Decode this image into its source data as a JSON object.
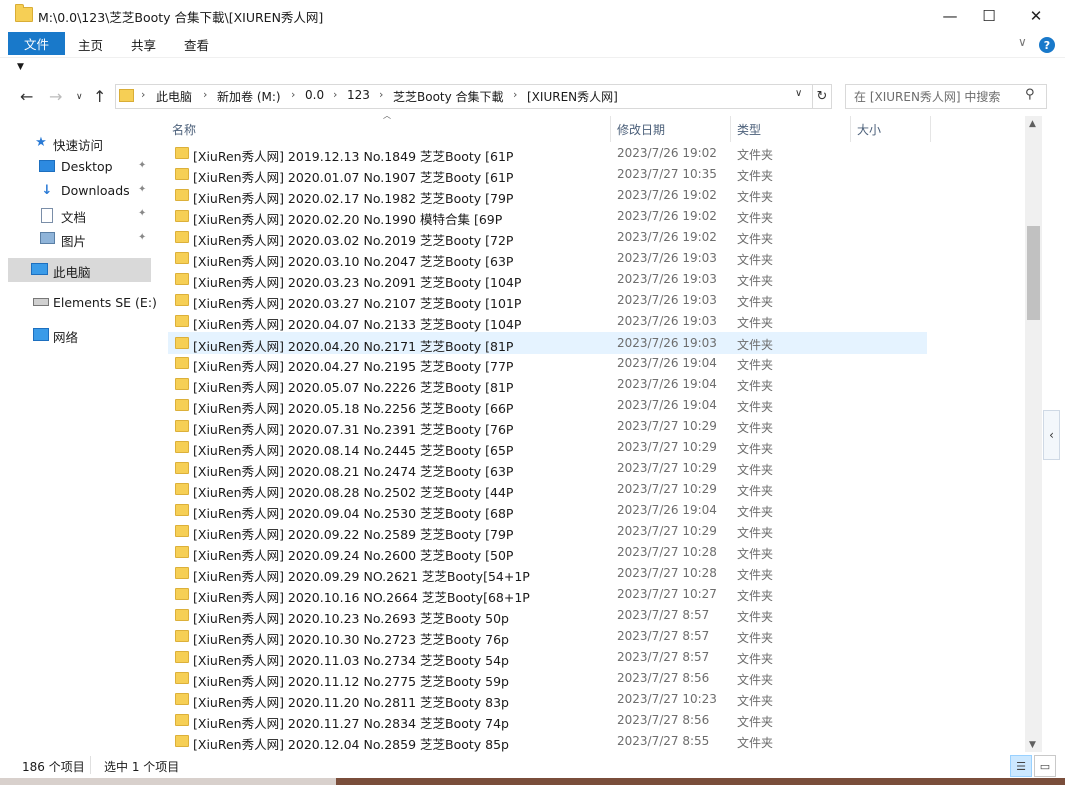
{
  "window": {
    "title": "M:\\0.0\\123\\芝芝Booty 合集下載\\[XIUREN秀人网]",
    "minimize": "—",
    "maximize": "☐",
    "close": "✕"
  },
  "ribbon": {
    "file": "文件",
    "tabs": [
      "主页",
      "共享",
      "查看"
    ],
    "help": "?"
  },
  "address": {
    "crumbs": [
      "此电脑",
      "新加卷 (M:)",
      "0.0",
      "123",
      "芝芝Booty 合集下載",
      "[XIUREN秀人网]"
    ],
    "search_placeholder": "在 [XIUREN秀人网] 中搜索"
  },
  "nav": {
    "quick_access": "快速访问",
    "desktop": "Desktop",
    "downloads": "Downloads",
    "documents": "文档",
    "pictures": "图片",
    "this_pc": "此电脑",
    "elements": "Elements SE (E:)",
    "network": "网络"
  },
  "columns": {
    "name": "名称",
    "date": "修改日期",
    "type": "类型",
    "size": "大小"
  },
  "files": [
    {
      "name": "[XiuRen秀人网] 2019.12.13 No.1849 芝芝Booty [61P",
      "date": "2023/7/26 19:02",
      "type": "文件夹"
    },
    {
      "name": "[XiuRen秀人网] 2020.01.07 No.1907 芝芝Booty [61P",
      "date": "2023/7/27 10:35",
      "type": "文件夹"
    },
    {
      "name": "[XiuRen秀人网] 2020.02.17 No.1982 芝芝Booty [79P",
      "date": "2023/7/26 19:02",
      "type": "文件夹"
    },
    {
      "name": "[XiuRen秀人网] 2020.02.20 No.1990 模特合集 [69P",
      "date": "2023/7/26 19:02",
      "type": "文件夹"
    },
    {
      "name": "[XiuRen秀人网] 2020.03.02 No.2019 芝芝Booty [72P",
      "date": "2023/7/26 19:02",
      "type": "文件夹"
    },
    {
      "name": "[XiuRen秀人网] 2020.03.10 No.2047 芝芝Booty [63P",
      "date": "2023/7/26 19:03",
      "type": "文件夹"
    },
    {
      "name": "[XiuRen秀人网] 2020.03.23 No.2091 芝芝Booty [104P",
      "date": "2023/7/26 19:03",
      "type": "文件夹"
    },
    {
      "name": "[XiuRen秀人网] 2020.03.27 No.2107 芝芝Booty [101P",
      "date": "2023/7/26 19:03",
      "type": "文件夹"
    },
    {
      "name": "[XiuRen秀人网] 2020.04.07 No.2133 芝芝Booty [104P",
      "date": "2023/7/26 19:03",
      "type": "文件夹"
    },
    {
      "name": "[XiuRen秀人网] 2020.04.20 No.2171 芝芝Booty [81P",
      "date": "2023/7/26 19:03",
      "type": "文件夹"
    },
    {
      "name": "[XiuRen秀人网] 2020.04.27 No.2195 芝芝Booty [77P",
      "date": "2023/7/26 19:04",
      "type": "文件夹"
    },
    {
      "name": "[XiuRen秀人网] 2020.05.07 No.2226 芝芝Booty [81P",
      "date": "2023/7/26 19:04",
      "type": "文件夹"
    },
    {
      "name": "[XiuRen秀人网] 2020.05.18 No.2256 芝芝Booty [66P",
      "date": "2023/7/26 19:04",
      "type": "文件夹"
    },
    {
      "name": "[XiuRen秀人网] 2020.07.31 No.2391 芝芝Booty [76P",
      "date": "2023/7/27 10:29",
      "type": "文件夹"
    },
    {
      "name": "[XiuRen秀人网] 2020.08.14 No.2445 芝芝Booty [65P",
      "date": "2023/7/27 10:29",
      "type": "文件夹"
    },
    {
      "name": "[XiuRen秀人网] 2020.08.21 No.2474 芝芝Booty [63P",
      "date": "2023/7/27 10:29",
      "type": "文件夹"
    },
    {
      "name": "[XiuRen秀人网] 2020.08.28 No.2502 芝芝Booty [44P",
      "date": "2023/7/27 10:29",
      "type": "文件夹"
    },
    {
      "name": "[XiuRen秀人网] 2020.09.04 No.2530 芝芝Booty [68P",
      "date": "2023/7/26 19:04",
      "type": "文件夹"
    },
    {
      "name": "[XiuRen秀人网] 2020.09.22 No.2589 芝芝Booty [79P",
      "date": "2023/7/27 10:29",
      "type": "文件夹"
    },
    {
      "name": "[XiuRen秀人网] 2020.09.24 No.2600 芝芝Booty [50P",
      "date": "2023/7/27 10:28",
      "type": "文件夹"
    },
    {
      "name": "[XiuRen秀人网] 2020.09.29 NO.2621 芝芝Booty[54+1P",
      "date": "2023/7/27 10:28",
      "type": "文件夹"
    },
    {
      "name": "[XiuRen秀人网] 2020.10.16 NO.2664 芝芝Booty[68+1P",
      "date": "2023/7/27 10:27",
      "type": "文件夹"
    },
    {
      "name": "[XiuRen秀人网] 2020.10.23 No.2693 芝芝Booty 50p",
      "date": "2023/7/27 8:57",
      "type": "文件夹"
    },
    {
      "name": "[XiuRen秀人网] 2020.10.30 No.2723 芝芝Booty 76p",
      "date": "2023/7/27 8:57",
      "type": "文件夹"
    },
    {
      "name": "[XiuRen秀人网] 2020.11.03 No.2734 芝芝Booty 54p",
      "date": "2023/7/27 8:57",
      "type": "文件夹"
    },
    {
      "name": "[XiuRen秀人网] 2020.11.12 No.2775 芝芝Booty 59p",
      "date": "2023/7/27 8:56",
      "type": "文件夹"
    },
    {
      "name": "[XiuRen秀人网] 2020.11.20 No.2811 芝芝Booty 83p",
      "date": "2023/7/27 10:23",
      "type": "文件夹"
    },
    {
      "name": "[XiuRen秀人网] 2020.11.27 No.2834 芝芝Booty 74p",
      "date": "2023/7/27 8:56",
      "type": "文件夹"
    },
    {
      "name": "[XiuRen秀人网] 2020.12.04 No.2859 芝芝Booty 85p",
      "date": "2023/7/27 8:55",
      "type": "文件夹"
    }
  ],
  "selected_index": 9,
  "status": {
    "count": "186 个项目",
    "selected": "选中 1 个项目"
  },
  "colors": {
    "accent": "#1979ca",
    "selection": "#e5f3ff",
    "folder": "#f6cf55"
  }
}
